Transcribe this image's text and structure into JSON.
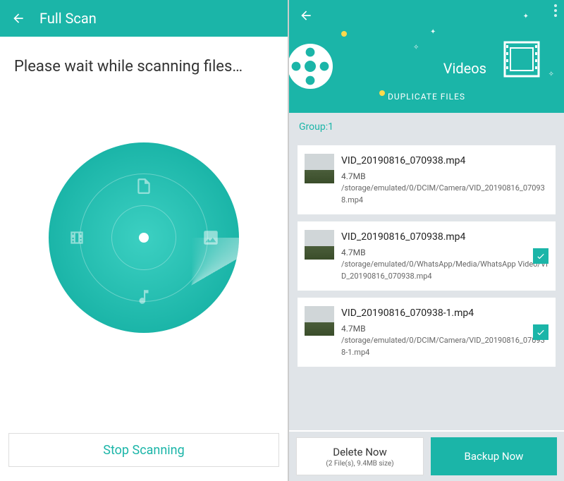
{
  "left": {
    "header_title": "Full Scan",
    "wait_message": "Please wait while scanning files…",
    "stop_button": "Stop Scanning"
  },
  "right": {
    "header_title": "Videos",
    "header_sub": "DUPLICATE FILES",
    "group_label": "Group:1",
    "files": [
      {
        "name": "VID_20190816_070938.mp4",
        "size": "4.7MB",
        "path": "/storage/emulated/0/DCIM/Camera/VID_20190816_070938.mp4",
        "checked": false
      },
      {
        "name": "VID_20190816_070938.mp4",
        "size": "4.7MB",
        "path": "/storage/emulated/0/WhatsApp/Media/WhatsApp Video/VID_20190816_070938.mp4",
        "checked": true
      },
      {
        "name": "VID_20190816_070938-1.mp4",
        "size": "4.7MB",
        "path": "/storage/emulated/0/DCIM/Camera/VID_20190816_070938-1.mp4",
        "checked": true
      }
    ],
    "delete_label": "Delete Now",
    "delete_sub": "(2 File(s), 9.4MB size)",
    "backup_label": "Backup Now"
  }
}
